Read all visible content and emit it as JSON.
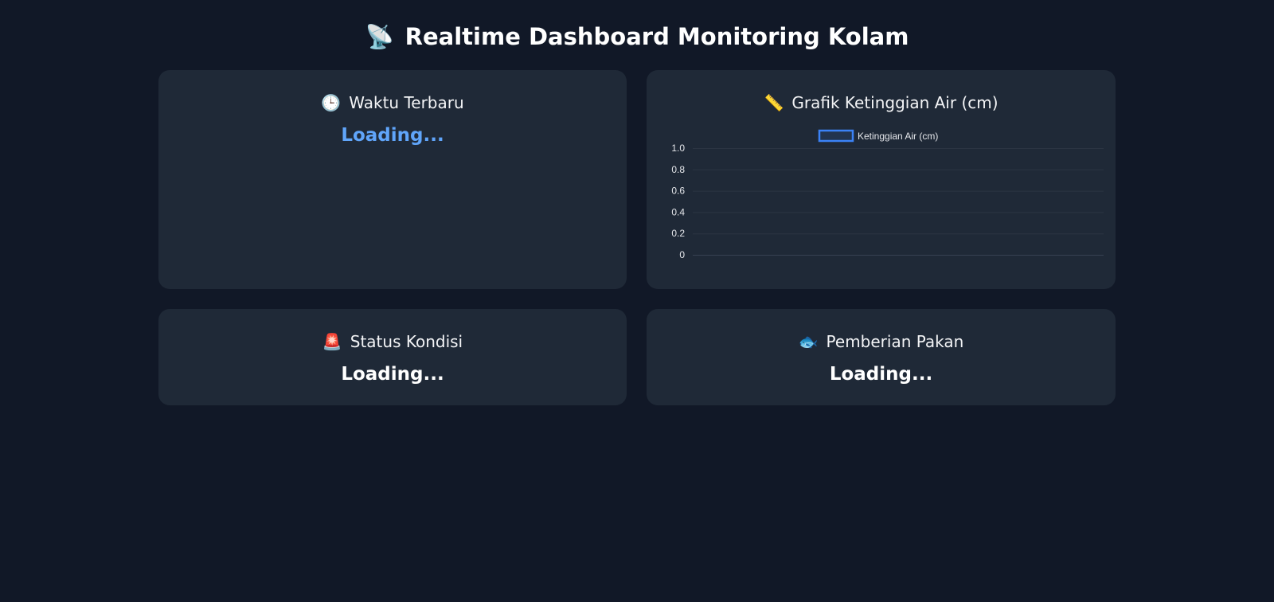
{
  "header": {
    "icon": "satellite-antenna-icon",
    "emoji": "📡",
    "title": "Realtime Dashboard Monitoring Kolam"
  },
  "cards": {
    "time": {
      "icon": "clock-icon",
      "emoji": "🕒",
      "title": "Waktu Terbaru",
      "value": "Loading..."
    },
    "chart": {
      "icon": "ruler-icon",
      "emoji": "📏",
      "title": "Grafik Ketinggian Air (cm)"
    },
    "status": {
      "icon": "siren-icon",
      "emoji": "🚨",
      "title": "Status Kondisi",
      "value": "Loading..."
    },
    "feed": {
      "icon": "fish-icon",
      "emoji": "🐟",
      "title": "Pemberian Pakan",
      "value": "Loading..."
    }
  },
  "colors": {
    "page_bg": "#111827",
    "card_bg": "#1f2937",
    "accent": "#60a5fa",
    "legend_border": "#3b82f6"
  },
  "chart_data": {
    "type": "line",
    "title": "",
    "x": [],
    "series": [
      {
        "name": "Ketinggian Air (cm)",
        "values": []
      }
    ],
    "yticks": [
      "1.0",
      "0.8",
      "0.6",
      "0.4",
      "0.2",
      "0"
    ],
    "ylim": [
      0,
      1.0
    ],
    "grid": true,
    "legend_position": "top-center"
  }
}
